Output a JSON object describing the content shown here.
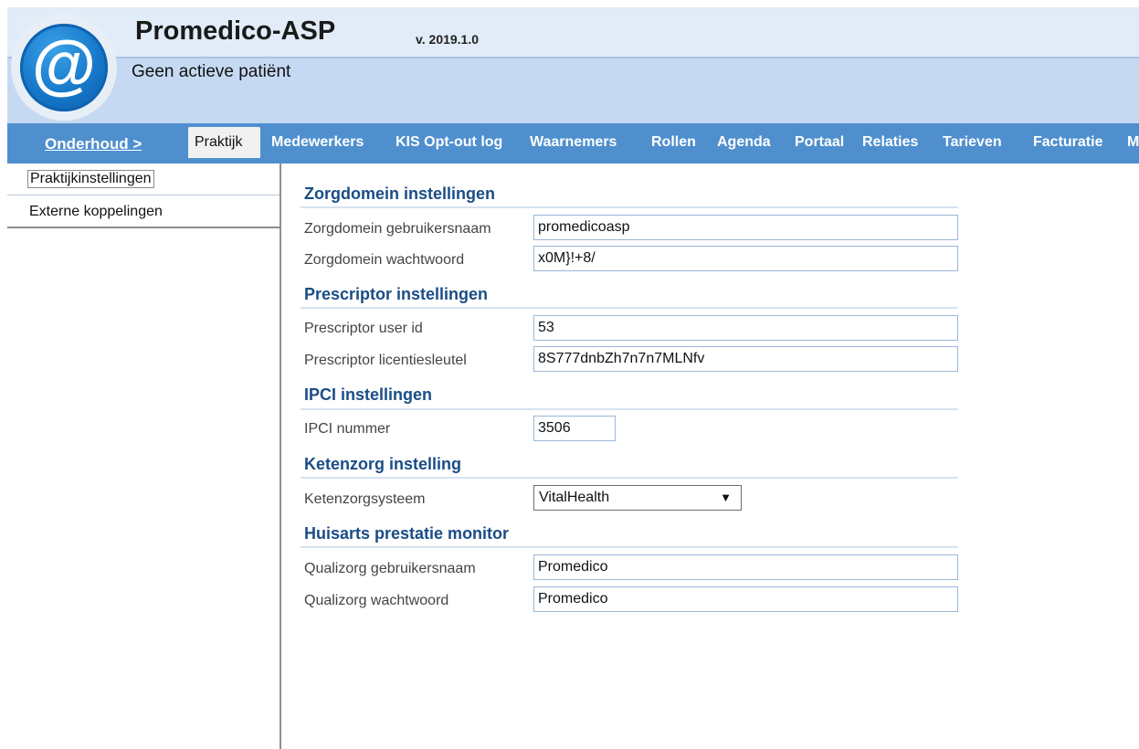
{
  "header": {
    "app_title": "Promedico-ASP",
    "version": "v. 2019.1.0",
    "patient_status": "Geen actieve patiënt",
    "logo_icon": "at-sign-icon"
  },
  "menu": {
    "onderhoud": "Onderhoud >",
    "items": [
      {
        "label": "Praktijk",
        "active": true
      },
      {
        "label": "Medewerkers"
      },
      {
        "label": "KIS Opt-out log"
      },
      {
        "label": "Waarnemers"
      },
      {
        "label": "Rollen"
      },
      {
        "label": "Agenda"
      },
      {
        "label": "Portaal"
      },
      {
        "label": "Relaties"
      },
      {
        "label": "Tarieven"
      },
      {
        "label": "Facturatie"
      },
      {
        "label": "M"
      }
    ]
  },
  "sidebar": {
    "items": [
      {
        "label": "Praktijkinstellingen"
      },
      {
        "label": "Externe koppelingen"
      }
    ]
  },
  "sections": {
    "zorgdomein": {
      "title": "Zorgdomein instellingen",
      "username_label": "Zorgdomein gebruikersnaam",
      "username_value": "promedicoasp",
      "password_label": "Zorgdomein wachtwoord",
      "password_value": "x0M}!+8/"
    },
    "prescriptor": {
      "title": "Prescriptor instellingen",
      "userid_label": "Prescriptor user id",
      "userid_value": "53",
      "license_label": "Prescriptor licentiesleutel",
      "license_value": "8S777dnbZh7n7n7MLNfv"
    },
    "ipci": {
      "title": "IPCI instellingen",
      "number_label": "IPCI nummer",
      "number_value": "3506"
    },
    "ketenzorg": {
      "title": "Ketenzorg instelling",
      "system_label": "Ketenzorgsysteem",
      "system_value": "VitalHealth"
    },
    "hpm": {
      "title": "Huisarts prestatie monitor",
      "username_label": "Qualizorg gebruikersnaam",
      "username_value": "Promedico",
      "password_label": "Qualizorg wachtwoord",
      "password_value": "Promedico"
    }
  },
  "colors": {
    "menu_bar": "#4f8fce",
    "header_bg": "#c5daf2",
    "section_title": "#1a4d86"
  }
}
